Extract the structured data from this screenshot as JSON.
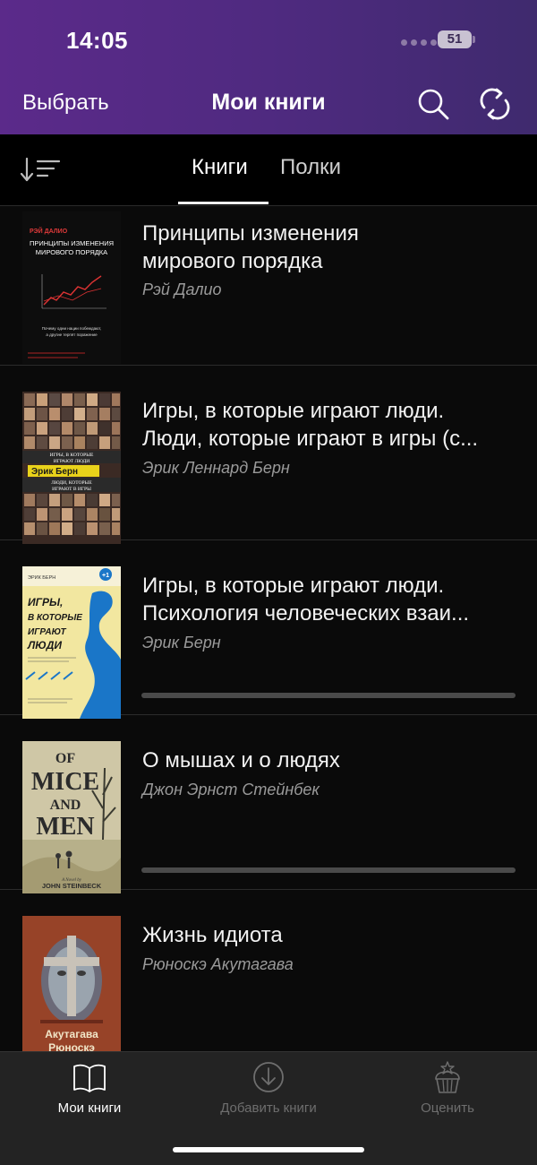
{
  "status": {
    "time": "14:05",
    "battery": "51"
  },
  "header": {
    "select_label": "Выбрать",
    "title": "Мои книги"
  },
  "tabs": [
    {
      "label": "Книги",
      "active": true
    },
    {
      "label": "Полки",
      "active": false
    }
  ],
  "books": [
    {
      "title_lines": [
        "Принципы изменения",
        "мирового порядка"
      ],
      "author": "Рэй Далио",
      "cover": {
        "author": "РЭЙ ДАЛИО",
        "title_line1": "ПРИНЦИПЫ ИЗМЕНЕНИЯ",
        "title_line2": "МИРОВОГО ПОРЯДКА",
        "tagline_line1": "Почему одни нации побеждают,",
        "tagline_line2": "а другие терпят поражение"
      }
    },
    {
      "title_lines": [
        "Игры, в которые играют люди.",
        "Люди, которые играют в игры (с..."
      ],
      "author": "Эрик Леннард Берн",
      "cover": {
        "line1": "ИГРЫ, В КОТОРЫЕ",
        "line2": "ИГРАЮТ ЛЮДИ",
        "author": "Эрик Берн",
        "line3": "ЛЮДИ, КОТОРЫЕ",
        "line4": "ИГРАЮТ В ИГРЫ"
      }
    },
    {
      "title_lines": [
        "Игры, в которые играют люди.",
        "Психология человеческих взаи..."
      ],
      "author": "Эрик Берн",
      "progress": 0.0,
      "cover": {
        "author": "ЭРИК БЕРН",
        "badge": "+1",
        "line1": "ИГРЫ,",
        "line2": "В КОТОРЫЕ",
        "line3": "ИГРАЮТ",
        "line4": "ЛЮДИ"
      }
    },
    {
      "title_lines": [
        "О мышах и о людях"
      ],
      "author": "Джон Эрнст Стейнбек",
      "progress": 0.0,
      "cover": {
        "line1": "OF",
        "line2": "MICE",
        "line3": "AND",
        "line4": "MEN",
        "byline": "A Novel by",
        "author": "JOHN STEINBECK"
      }
    },
    {
      "title_lines": [
        "Жизнь идиота"
      ],
      "author": "Рюноскэ Акутагава",
      "cover": {
        "line1": "Акутагава",
        "line2": "Рюноскэ"
      }
    }
  ],
  "tab_bar": [
    {
      "label": "Мои книги",
      "icon": "book-open-icon",
      "active": true
    },
    {
      "label": "Добавить книги",
      "icon": "download-circle-icon",
      "active": false
    },
    {
      "label": "Оценить",
      "icon": "cupcake-icon",
      "active": false
    }
  ]
}
